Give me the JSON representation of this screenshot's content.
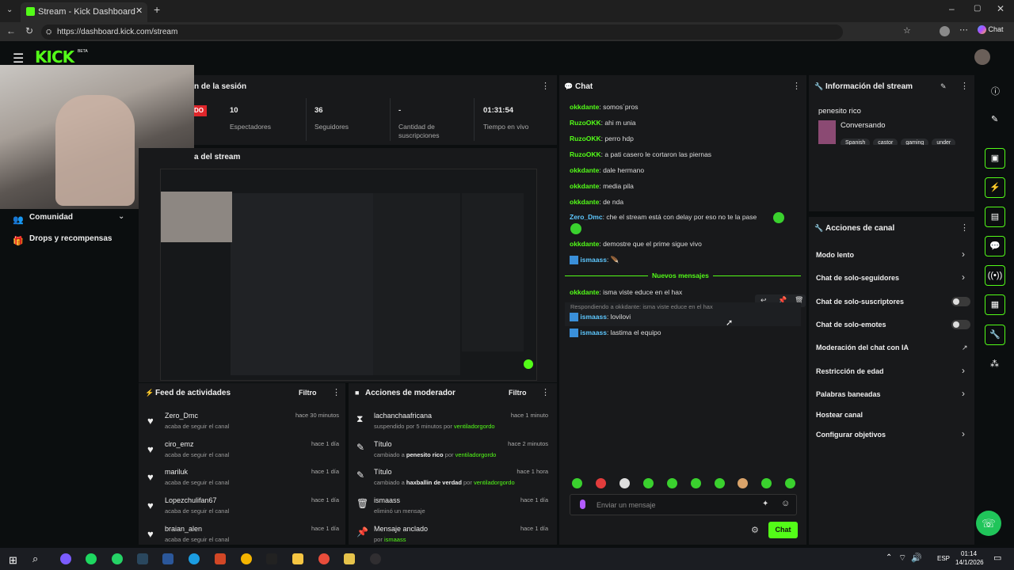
{
  "browser": {
    "tab_title": "Stream - Kick Dashboard",
    "url": "https://dashboard.kick.com/stream",
    "chat_button": "Chat"
  },
  "app": {
    "logo": "KICK",
    "logo_badge": "BETA"
  },
  "session": {
    "title": "n de la sesión",
    "live_badge": "DO",
    "stats": [
      {
        "value": "10",
        "label": "Espectadores"
      },
      {
        "value": "36",
        "label": "Seguidores"
      },
      {
        "value": "-",
        "label": "Cantidad de suscripciones"
      },
      {
        "value": "01:31:54",
        "label": "Tiempo en vivo"
      }
    ]
  },
  "preview": {
    "title": "a del stream"
  },
  "sidebar": {
    "items": [
      {
        "label": "Comunidad"
      },
      {
        "label": "Drops y recompensas"
      }
    ]
  },
  "activity": {
    "title": "Feed de actividades",
    "filter": "Filtro",
    "items": [
      {
        "name": "Zero_Dmc",
        "sub": "acaba de seguir el canal",
        "time": "hace 30 minutos"
      },
      {
        "name": "ciro_emz",
        "sub": "acaba de seguir el canal",
        "time": "hace 1 día"
      },
      {
        "name": "mariluk",
        "sub": "acaba de seguir el canal",
        "time": "hace 1 día"
      },
      {
        "name": "Lopezchulifan67",
        "sub": "acaba de seguir el canal",
        "time": "hace 1 día"
      },
      {
        "name": "braian_alen",
        "sub": "acaba de seguir el canal",
        "time": "hace 1 día"
      }
    ]
  },
  "mod": {
    "title": "Acciones de moderador",
    "filter": "Filtro",
    "items": [
      {
        "name": "lachanchaafricana",
        "sub": "suspendido por 5 minutos por",
        "actor": "ventiladorgordo",
        "time": "hace 1 minuto"
      },
      {
        "name": "Título",
        "sub": "cambiado a",
        "value": "penesito rico",
        "by": "por",
        "actor": "ventiladorgordo",
        "time": "hace 2 minutos"
      },
      {
        "name": "Título",
        "sub": "cambiado a",
        "value": "haxballin de verdad",
        "by": "por",
        "actor": "ventiladorgordo",
        "time": "hace 1 hora"
      },
      {
        "name": "ismaass",
        "sub": "eliminó un mensaje",
        "time": "hace 1 día"
      },
      {
        "name": "Mensaje anclado",
        "sub": "por",
        "actor": "ismaass",
        "time": "hace 1 día"
      }
    ]
  },
  "chat": {
    "title": "Chat",
    "messages": [
      {
        "user": "okkdante",
        "text": "somos´pros"
      },
      {
        "user": "RuzoOKK",
        "text": "ahi m unia"
      },
      {
        "user": "RuzoOKK",
        "text": "perro hdp"
      },
      {
        "user": "RuzoOKK",
        "text": "a pati casero le cortaron las piernas"
      },
      {
        "user": "okkdante",
        "text": "dale hermano"
      },
      {
        "user": "okkdante",
        "text": "media pila"
      },
      {
        "user": "okkdante",
        "text": "de nda"
      },
      {
        "user": "Zero_Dmc",
        "text": "che el stream está con delay por eso no te la pase"
      },
      {
        "user": "okkdante",
        "text": "demostre que el prime sigue vivo"
      },
      {
        "user": "ismaass",
        "text": ""
      }
    ],
    "new_messages": "Nuevos mensajes",
    "after": [
      {
        "user": "okkdante",
        "text": "isma viste educe en el hax"
      }
    ],
    "reply_hint": "Respondiendo a okkdante: isma viste educe en el hax",
    "replies": [
      {
        "user": "ismaass",
        "text": "lovilovi"
      },
      {
        "user": "ismaass",
        "text": "lastima el equipo"
      }
    ],
    "input_placeholder": "Enviar un mensaje",
    "send": "Chat"
  },
  "stream_info": {
    "title": "Información del stream",
    "stream_title": "penesito rico",
    "category": "Conversando",
    "tags": [
      "Spanish",
      "castor",
      "gaming",
      "under"
    ]
  },
  "channel_actions": {
    "title": "Acciones de canal",
    "items": [
      {
        "label": "Modo lento",
        "control": "arrow"
      },
      {
        "label": "Chat de solo-seguidores",
        "control": "arrow"
      },
      {
        "label": "Chat de solo-suscriptores",
        "control": "toggle"
      },
      {
        "label": "Chat de solo-emotes",
        "control": "toggle"
      },
      {
        "label": "Moderación del chat con IA",
        "control": "external"
      },
      {
        "label": "Restricción de edad",
        "control": "arrow"
      },
      {
        "label": "Palabras baneadas",
        "control": "arrow"
      },
      {
        "label": "Hostear canal",
        "control": "none"
      },
      {
        "label": "Configurar objetivos",
        "control": "arrow"
      }
    ]
  },
  "taskbar": {
    "lang": "ESP",
    "time": "01:14",
    "date": "14/1/2026"
  },
  "colors": {
    "accent": "#53fc18",
    "panel": "#18191b",
    "bg": "#0b0e0f"
  }
}
